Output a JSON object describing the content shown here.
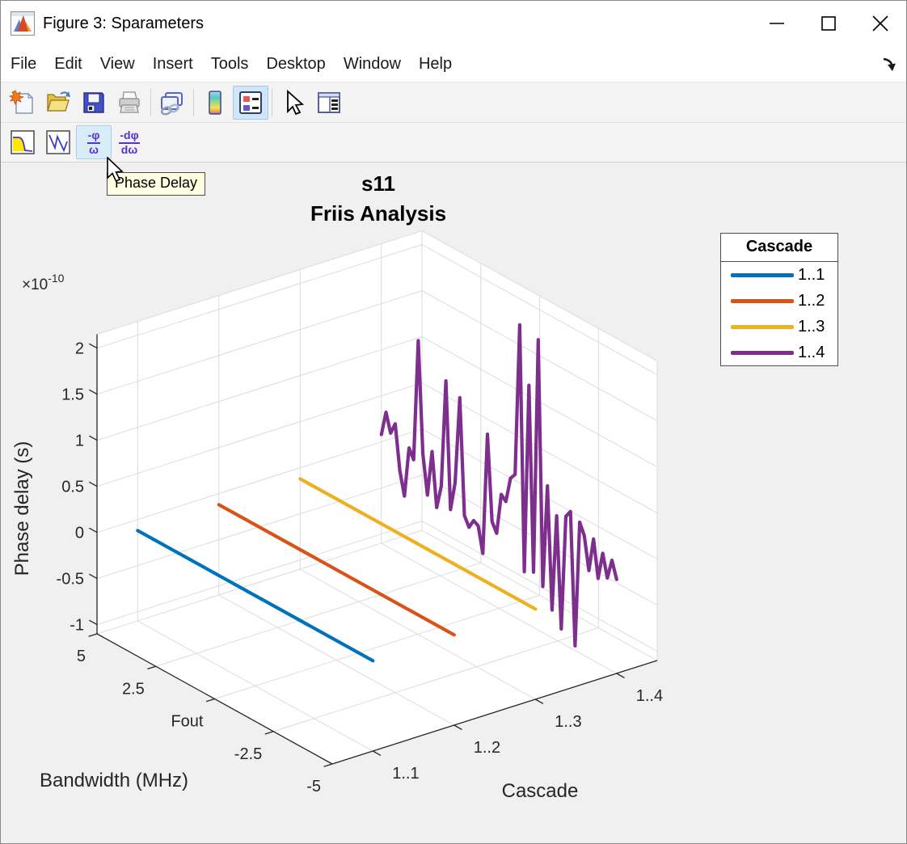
{
  "window": {
    "title": "Figure 3: Sparameters",
    "controls": {
      "minimize": "minimize",
      "maximize": "maximize",
      "close": "close"
    }
  },
  "menu": {
    "items": [
      "File",
      "Edit",
      "View",
      "Insert",
      "Tools",
      "Desktop",
      "Window",
      "Help"
    ]
  },
  "toolbar_main": {
    "icons": [
      "new-figure",
      "open-file",
      "save-figure",
      "print-figure",
      "link-plot",
      "insert-colorbar",
      "insert-legend",
      "edit-plot",
      "property-editor"
    ],
    "active_button": "insert-legend"
  },
  "rf_toolbar": {
    "icons": [
      "magnitude",
      "angle",
      "phase-delay",
      "group-delay"
    ],
    "hovered_button": "phase-delay",
    "phase_delay_glyph": {
      "num": "-φ",
      "den": "ω"
    },
    "group_delay_glyph": {
      "num": "-dφ",
      "den": "dω"
    }
  },
  "tooltip": {
    "text": "Phase Delay"
  },
  "chart_data": {
    "type": "line",
    "projection": "3d",
    "title_lines": [
      "s11",
      "Friis Analysis"
    ],
    "xlabel": "Bandwidth (MHz)",
    "ylabel": "Cascade",
    "zlabel": "Phase delay (s)",
    "z_exponent_base": "×10",
    "z_exponent_power": "-10",
    "z_units_note": "z values in units of 1e-10 seconds",
    "xlim": [
      5,
      -5
    ],
    "ylim": [
      0.5,
      4.5
    ],
    "zlim": [
      -1.1,
      2.15
    ],
    "grid": true,
    "x_ticks": {
      "values": [
        5,
        2.5,
        0,
        -2.5,
        -5
      ],
      "labels": [
        "5",
        "2.5",
        "Fout",
        "-2.5",
        "-5"
      ]
    },
    "y_ticks": {
      "values": [
        1,
        2,
        3,
        4
      ],
      "labels": [
        "1..1",
        "1..2",
        "1..3",
        "1..4"
      ]
    },
    "z_ticks": {
      "values": [
        -1,
        -0.5,
        0,
        0.5,
        1,
        1.5,
        2
      ],
      "labels": [
        "-1",
        "-0.5",
        "0",
        "0.5",
        "1",
        "1.5",
        "2"
      ]
    },
    "legend": {
      "title": "Cascade",
      "position": "outside-right",
      "entries": [
        {
          "label": "1..1",
          "color": "#0072BD"
        },
        {
          "label": "1..2",
          "color": "#D95319"
        },
        {
          "label": "1..3",
          "color": "#EDB120"
        },
        {
          "label": "1..4",
          "color": "#7E2F8E"
        }
      ]
    },
    "series": [
      {
        "name": "1..1",
        "y": 1,
        "color": "#0072BD",
        "x": [
          5,
          -5
        ],
        "z": [
          -0.12,
          -0.12
        ]
      },
      {
        "name": "1..2",
        "y": 2,
        "color": "#D95319",
        "x": [
          5,
          -5
        ],
        "z": [
          -0.12,
          -0.12
        ]
      },
      {
        "name": "1..3",
        "y": 3,
        "color": "#EDB120",
        "x": [
          5,
          -5
        ],
        "z": [
          -0.12,
          -0.12
        ]
      },
      {
        "name": "1..4",
        "y": 4,
        "color": "#7E2F8E",
        "x_range": [
          5,
          -5
        ],
        "z": [
          0.08,
          0.35,
          0.15,
          0.28,
          -0.2,
          -0.45,
          0.1,
          0.0,
          1.32,
          0.12,
          -0.3,
          0.2,
          -0.38,
          -0.12,
          1.05,
          -0.32,
          0.0,
          0.95,
          -0.3,
          -0.4,
          -0.3,
          -0.33,
          -0.6,
          0.72,
          -0.2,
          -0.3,
          0.15,
          0.1,
          0.38,
          0.45,
          2.1,
          -0.55,
          1.5,
          -0.5,
          2.05,
          -0.6,
          0.52,
          -0.8,
          0.25,
          -0.95,
          0.3,
          0.38,
          -1.05,
          0.32,
          0.2,
          -0.15,
          0.22,
          -0.18,
          0.12,
          -0.12,
          0.1,
          -0.08
        ]
      }
    ]
  }
}
